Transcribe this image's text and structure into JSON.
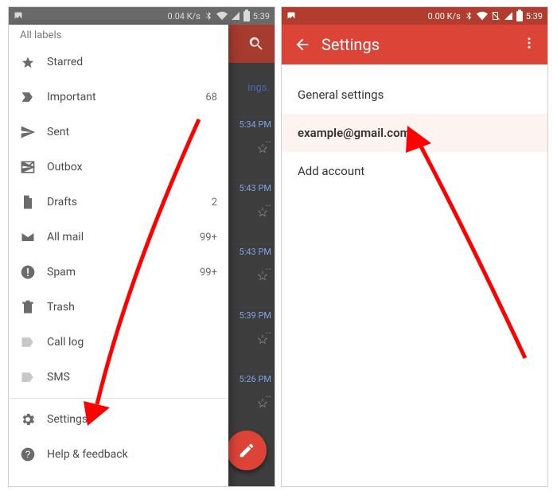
{
  "statusbar": {
    "left_speed": "0.04 K/s",
    "right_speed": "0.00 K/s",
    "time": "5:39"
  },
  "drawer": {
    "header": "All labels",
    "items": [
      {
        "icon": "star",
        "label": "Starred",
        "count": ""
      },
      {
        "icon": "important",
        "label": "Important",
        "count": "68"
      },
      {
        "icon": "sent",
        "label": "Sent",
        "count": ""
      },
      {
        "icon": "outbox",
        "label": "Outbox",
        "count": ""
      },
      {
        "icon": "drafts",
        "label": "Drafts",
        "count": "2"
      },
      {
        "icon": "allmail",
        "label": "All mail",
        "count": "99+"
      },
      {
        "icon": "spam",
        "label": "Spam",
        "count": "99+"
      },
      {
        "icon": "trash",
        "label": "Trash",
        "count": ""
      },
      {
        "icon": "label",
        "label": "Call log",
        "count": ""
      },
      {
        "icon": "label",
        "label": "SMS",
        "count": ""
      }
    ],
    "footer": [
      {
        "icon": "gear",
        "label": "Settings"
      },
      {
        "icon": "help",
        "label": "Help & feedback"
      }
    ]
  },
  "inbox_peek": {
    "link_text": "ings.",
    "rows": [
      {
        "time": "5:34 PM"
      },
      {
        "time": "5:43 PM"
      },
      {
        "time": "5:43 PM"
      },
      {
        "time": "5:39 PM"
      },
      {
        "time": "5:26 PM"
      }
    ],
    "ellipsis": ".."
  },
  "settings": {
    "title": "Settings",
    "items": [
      {
        "label": "General settings",
        "kind": "plain"
      },
      {
        "label": "example@gmail.com",
        "kind": "account"
      },
      {
        "label": "Add account",
        "kind": "plain"
      }
    ]
  },
  "colors": {
    "accent": "#db4437"
  }
}
